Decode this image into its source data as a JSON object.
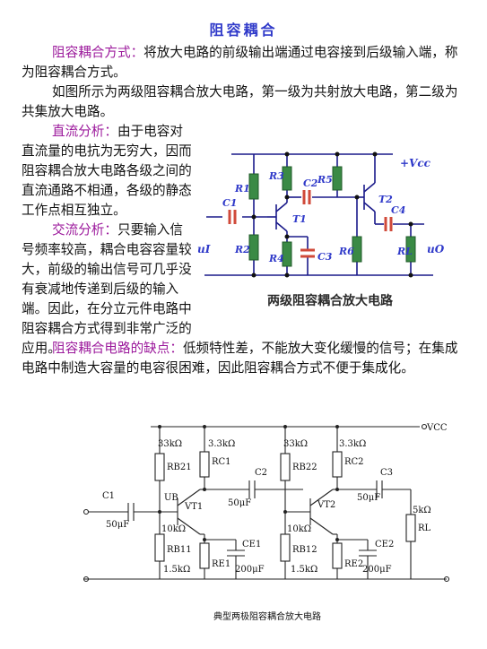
{
  "title": "阻容耦合",
  "paragraph1": {
    "term": "阻容耦合方式：",
    "text": "将放大电路的前级输出端通过电容接到后级输入端，称为阻容耦合方式。"
  },
  "paragraph2": {
    "text": "如图所示为两级阻容耦合放大电路，第一级为共射放大电路，第二级为共集放大电路。"
  },
  "dc_analysis": {
    "term": "直流分析：",
    "text": "由于电容对直流量的电抗为无穷大，因而阻容耦合放大电路各级之间的直流通路不相通，各级的静态工作点相互独立。"
  },
  "ac_analysis": {
    "term": "交流分析：",
    "text": "只要输入信号频率较高，耦合电容容量较大，前级的输出信号可几乎没有衰减地传递到后级的输入端。因此，在分立元件电路中阻容耦合方式得到非常广泛的应用。"
  },
  "drawbacks": {
    "term": "阻容耦合电路的缺点：",
    "text": "低频特性差，不能放大变化缓慢的信号；在集成电路中制造大容量的电容很困难，因此阻容耦合方式不便于集成化。"
  },
  "figure1": {
    "caption": "两级阻容耦合放大电路",
    "labels": {
      "vcc": "+Vcc",
      "r1": "R1",
      "r2": "R2",
      "r3": "R3",
      "r4": "R4",
      "r5": "R5",
      "r6": "R6",
      "rl": "RL",
      "c1": "C1",
      "c2": "C2",
      "c3": "C3",
      "c4": "C4",
      "t1": "T1",
      "t2": "T2",
      "ui": "uI",
      "uo": "uO"
    }
  },
  "figure2": {
    "caption": "典型两极阻容耦合放大电路",
    "labels": {
      "vcc": "VCC",
      "rb21": "RB21",
      "rc1": "RC1",
      "rb22": "RB22",
      "rc2": "RC2",
      "rb11": "RB11",
      "re1": "RE1",
      "rb12": "RB12",
      "re2": "RE2",
      "rl": "RL",
      "c1": "C1",
      "c2": "C2",
      "c3": "C3",
      "ce1": "CE1",
      "ce2": "CE2",
      "vt1": "VT1",
      "vt2": "VT2",
      "ub": "UB",
      "v33k_a": "33kΩ",
      "v33k_b": "33kΩ",
      "v3_3k_a": "3.3kΩ",
      "v3_3k_b": "3.3kΩ",
      "v10k_a": "10kΩ",
      "v10k_b": "10kΩ",
      "v1_5k_a": "1.5kΩ",
      "v1_5k_b": "1.5kΩ",
      "v50u_a": "50μF",
      "v50u_b": "50μF",
      "v50u_c": "50μF",
      "v200u_a": "200μF",
      "v200u_b": "200μF",
      "v5k": "5kΩ"
    }
  },
  "colors": {
    "title": "#2f39c9",
    "term": "#9c1a9c",
    "resistor_fill": "#3a8a45",
    "capacitor": "#d04a3a",
    "wire": "#1a1a8a"
  }
}
